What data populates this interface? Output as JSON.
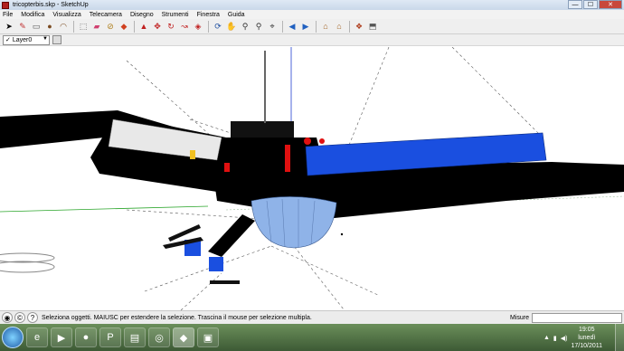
{
  "window": {
    "title": "tricopterbis.skp - SketchUp",
    "minimize": "—",
    "maximize": "☐",
    "close": "✕"
  },
  "menu": [
    "File",
    "Modifica",
    "Visualizza",
    "Telecamera",
    "Disegno",
    "Strumenti",
    "Finestra",
    "Guida"
  ],
  "toolbar": {
    "icons": [
      "select-arrow-icon",
      "pencil-line-icon",
      "rectangle-icon",
      "circle-icon",
      "arc-icon",
      "sep",
      "make-component-icon",
      "eraser-icon",
      "tape-measure-icon",
      "paint-bucket-icon",
      "sep",
      "push-pull-icon",
      "rotate-icon",
      "follow-me-icon",
      "move-icon",
      "offset-icon",
      "sep",
      "orbit-icon",
      "pan-icon",
      "zoom-icon",
      "zoom-window-icon",
      "zoom-extents-icon",
      "sep",
      "previous-view-icon",
      "next-view-icon",
      "sep",
      "3d-warehouse-get-icon",
      "3d-warehouse-share-icon",
      "sep",
      "get-models-icon",
      "share-component-icon"
    ]
  },
  "layers": {
    "current": "Layer0"
  },
  "status": {
    "hint": "Seleziona oggetti. MAIUSC per estendere la selezione. Trascina il mouse per selezione multipla.",
    "measurements_label": "Misure"
  },
  "taskbar": {
    "time": "19:05",
    "day": "lunedì",
    "date": "17/10/2011",
    "apps": [
      "explorer-icon",
      "media-player-icon",
      "firefox-icon",
      "powerpoint-icon",
      "folder-icon",
      "chrome-icon",
      "sketchup-icon",
      "app-icon"
    ]
  },
  "colors": {
    "body_blue": "#1a4fe0",
    "dome_blue": "#8fb3e8",
    "accent_red": "#e01010",
    "axis_green": "#2aa52a",
    "axis_blue": "#2040d0"
  }
}
